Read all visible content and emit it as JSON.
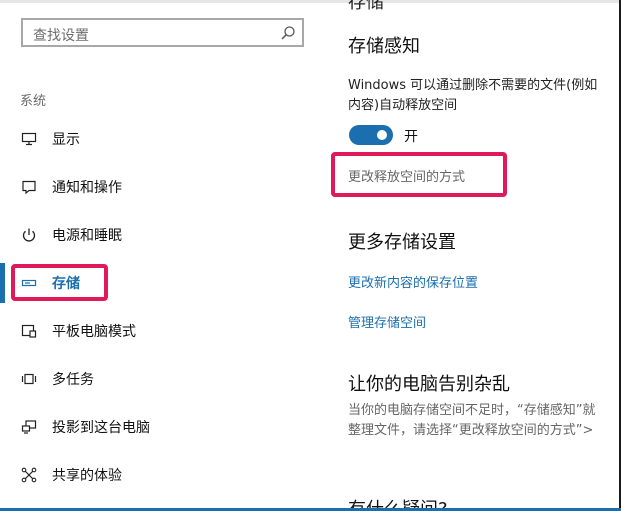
{
  "search": {
    "placeholder": "查找设置"
  },
  "sidebar": {
    "section": "系统",
    "items": [
      {
        "label": "显示",
        "icon": "monitor-icon"
      },
      {
        "label": "通知和操作",
        "icon": "notification-icon"
      },
      {
        "label": "电源和睡眠",
        "icon": "power-icon"
      },
      {
        "label": "存储",
        "icon": "storage-drive-icon",
        "active": true
      },
      {
        "label": "平板电脑模式",
        "icon": "tablet-mode-icon"
      },
      {
        "label": "多任务",
        "icon": "multitasking-icon"
      },
      {
        "label": "投影到这台电脑",
        "icon": "project-icon"
      },
      {
        "label": "共享的体验",
        "icon": "shared-experience-icon"
      }
    ]
  },
  "main": {
    "cut_top_heading": "存储",
    "storage_sense": {
      "title": "存储感知",
      "desc_line1": "Windows 可以通过删除不需要的文件(例如",
      "desc_line2": "内容)自动释放空间",
      "toggle_label": "开",
      "toggle_on": true,
      "change_link": "更改释放空间的方式"
    },
    "more_settings": {
      "title": "更多存储设置",
      "link1": "更改新内容的保存位置",
      "link2": "管理存储空间"
    },
    "declutter": {
      "title": "让你的电脑告别杂乱",
      "line1": "当你的电脑存储空间不足时，“存储感知”就",
      "line2": "整理文件，请选择“更改释放空间的方式”>"
    },
    "question": {
      "title": "有什么疑问?"
    }
  },
  "colors": {
    "accent": "#1b6fae",
    "highlight": "#e0195a"
  }
}
